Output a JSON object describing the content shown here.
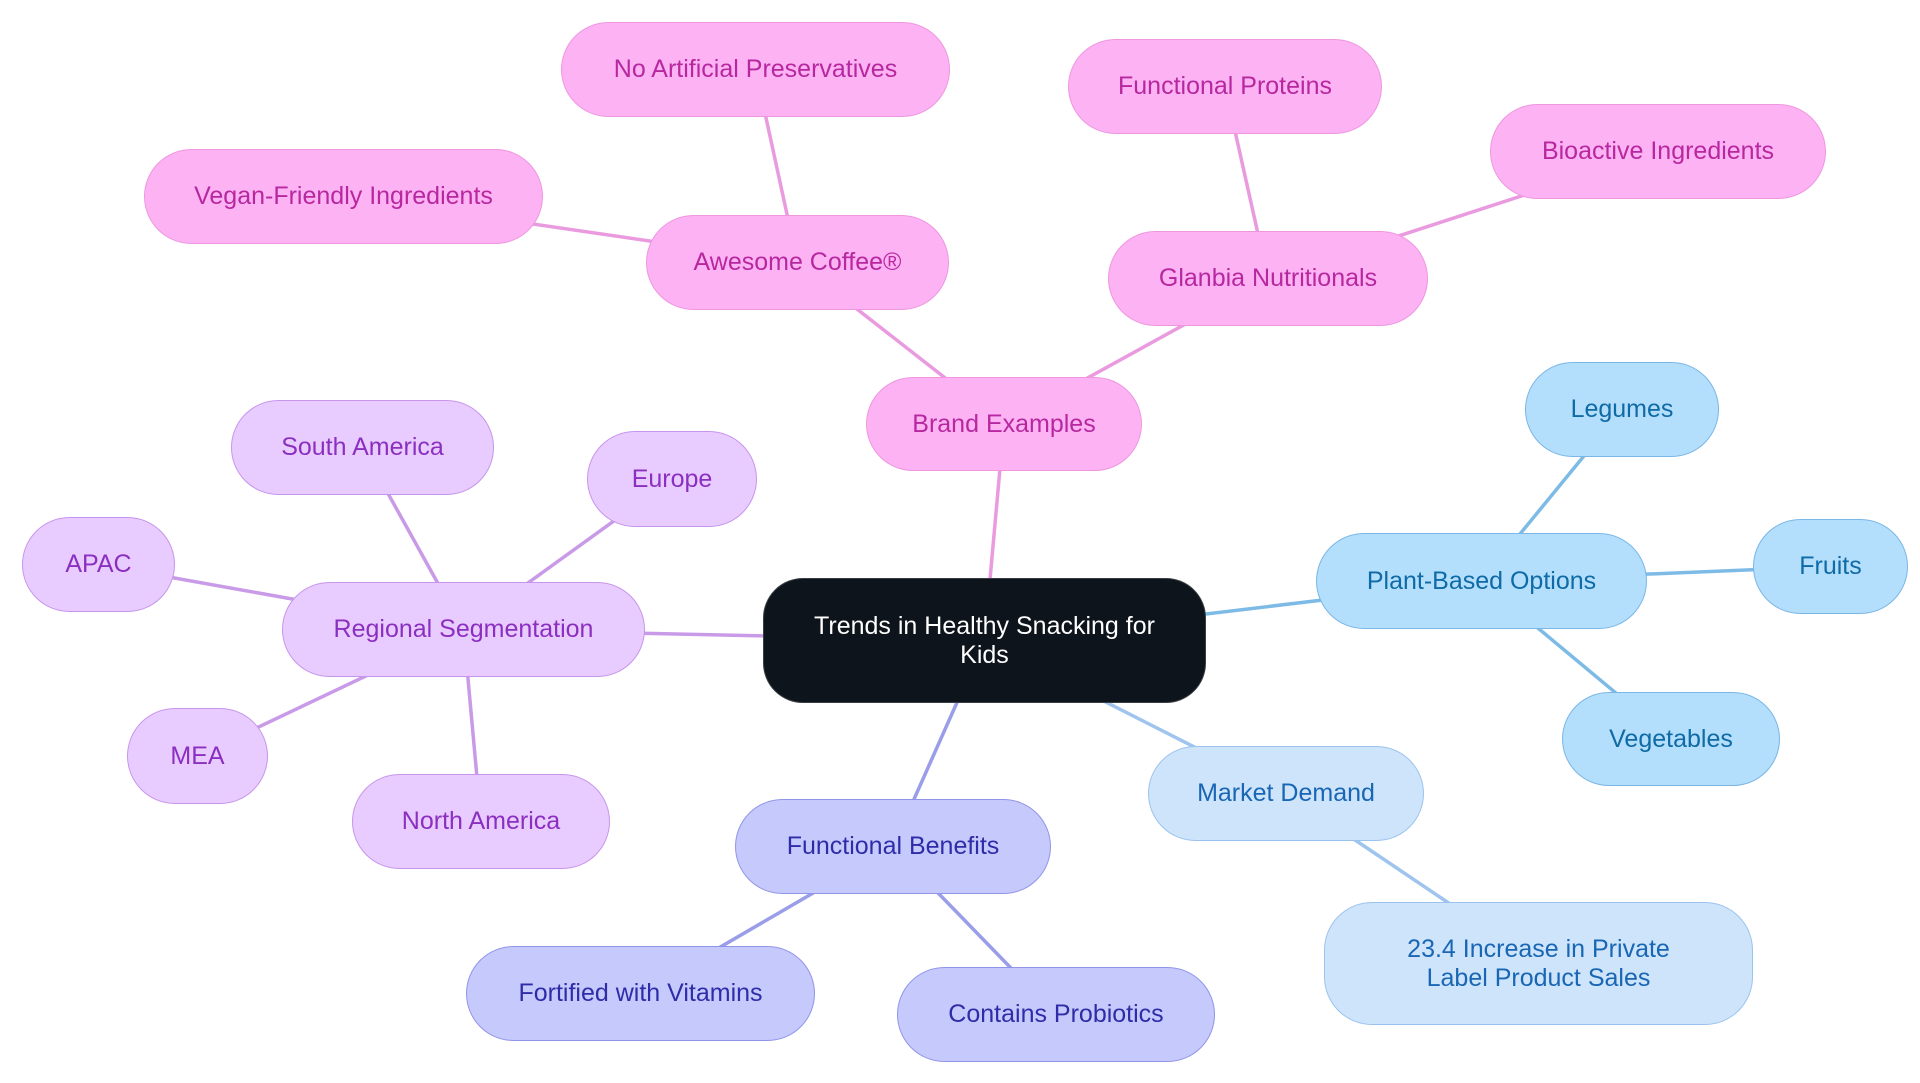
{
  "diagram": {
    "type": "mindmap",
    "root": {
      "id": "root",
      "label": "Trends in Healthy Snacking for Kids"
    },
    "colors": {
      "pink_edge": "#ea9ade",
      "lilac_edge": "#c89ae8",
      "blue_edge": "#7dbbe6",
      "paleblue_edge": "#9fc5ee",
      "indigo_edge": "#9a9de8"
    },
    "nodes": [
      {
        "id": "brand",
        "label": "Brand Examples",
        "parent": "root",
        "style": "pink"
      },
      {
        "id": "coffee",
        "label": "Awesome Coffee®",
        "parent": "brand",
        "style": "pink"
      },
      {
        "id": "nopres",
        "label": "No Artificial Preservatives",
        "parent": "coffee",
        "style": "pink"
      },
      {
        "id": "vegan",
        "label": "Vegan-Friendly Ingredients",
        "parent": "coffee",
        "style": "pink"
      },
      {
        "id": "glanbia",
        "label": "Glanbia Nutritionals",
        "parent": "brand",
        "style": "pink"
      },
      {
        "id": "proteins",
        "label": "Functional Proteins",
        "parent": "glanbia",
        "style": "pink"
      },
      {
        "id": "bioactive",
        "label": "Bioactive Ingredients",
        "parent": "glanbia",
        "style": "pink"
      },
      {
        "id": "plant",
        "label": "Plant-Based Options",
        "parent": "root",
        "style": "blue"
      },
      {
        "id": "legumes",
        "label": "Legumes",
        "parent": "plant",
        "style": "blue"
      },
      {
        "id": "fruits",
        "label": "Fruits",
        "parent": "plant",
        "style": "blue"
      },
      {
        "id": "vegetables",
        "label": "Vegetables",
        "parent": "plant",
        "style": "blue"
      },
      {
        "id": "market",
        "label": "Market Demand",
        "parent": "root",
        "style": "paleblue"
      },
      {
        "id": "private",
        "label": "23.4 Increase in Private Label Product Sales",
        "parent": "market",
        "style": "paleblue"
      },
      {
        "id": "functional",
        "label": "Functional Benefits",
        "parent": "root",
        "style": "indigo"
      },
      {
        "id": "vitamins",
        "label": "Fortified with Vitamins",
        "parent": "functional",
        "style": "indigo"
      },
      {
        "id": "probiotics",
        "label": "Contains Probiotics",
        "parent": "functional",
        "style": "indigo"
      },
      {
        "id": "regional",
        "label": "Regional Segmentation",
        "parent": "root",
        "style": "lilac"
      },
      {
        "id": "southam",
        "label": "South America",
        "parent": "regional",
        "style": "lilac"
      },
      {
        "id": "europe",
        "label": "Europe",
        "parent": "regional",
        "style": "lilac"
      },
      {
        "id": "apac",
        "label": "APAC",
        "parent": "regional",
        "style": "lilac"
      },
      {
        "id": "mea",
        "label": "MEA",
        "parent": "regional",
        "style": "lilac"
      },
      {
        "id": "northam",
        "label": "North America",
        "parent": "regional",
        "style": "lilac"
      }
    ]
  }
}
